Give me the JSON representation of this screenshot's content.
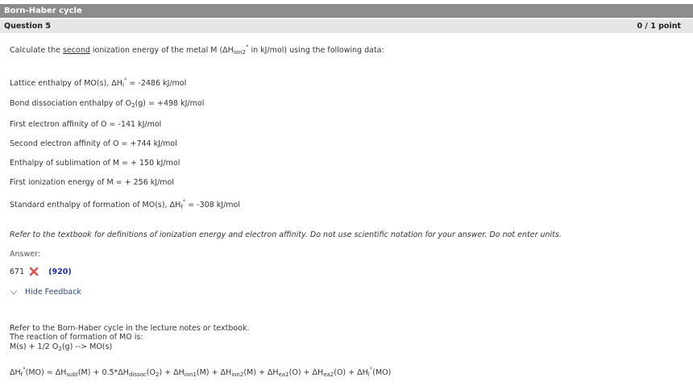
{
  "quiz": {
    "title": "Born-Haber cycle",
    "question_number": "Question 5",
    "points": "0 / 1 point"
  },
  "prompt": {
    "pre": "Calculate the ",
    "underlined": "second",
    "mid": " ionization energy of the metal M (ΔH",
    "sub": "ion2",
    "sup": "°",
    "post": " in kJ/mol) using the following data:"
  },
  "data_lines": [
    {
      "pre": "Lattice enthalpy of MO(s), ΔH",
      "sub": "l",
      "sup": "°",
      "post": " = -2486 kJ/mol"
    },
    {
      "pre": "Bond dissociation enthalpy of O",
      "sub": "2",
      "sup": "",
      "post": "(g) = +498 kJ/mol"
    },
    {
      "pre": "First electron affinity of O = -141 kJ/mol",
      "sub": "",
      "sup": "",
      "post": ""
    },
    {
      "pre": "Second electron affinity of O = +744 kJ/mol",
      "sub": "",
      "sup": "",
      "post": ""
    },
    {
      "pre": "Enthalpy of sublimation of M = + 150 kJ/mol",
      "sub": "",
      "sup": "",
      "post": ""
    },
    {
      "pre": "First ionization energy of M = + 256 kJ/mol",
      "sub": "",
      "sup": "",
      "post": ""
    },
    {
      "pre": "Standard enthalpy of formation of MO(s), ΔH",
      "sub": "f",
      "sup": "°",
      "post": " = -308 kJ/mol"
    }
  ],
  "instruction": "Refer to the textbook for definitions of ionization energy and electron affinity. Do not use scientific notation for your answer. Do not enter units.",
  "answer": {
    "label": "Answer:",
    "value": "671",
    "correct": "(920)",
    "status_icon": "x-icon",
    "status_color": "#e05050"
  },
  "feedback": {
    "toggle_label": "Hide Feedback",
    "line1": "Refer to the Born-Haber cycle in the lecture notes or textbook.",
    "line2": "The reaction of formation of MO is:",
    "line3": {
      "a": "M(s) + 1/2 O",
      "sub": "2",
      "b": "(g) --> MO(s)"
    },
    "equation": [
      {
        "t": "ΔH"
      },
      {
        "sub": "f"
      },
      {
        "sup": "°"
      },
      {
        "t": "(MO) = ΔH"
      },
      {
        "sub": "subl"
      },
      {
        "t": "(M) + 0.5*ΔH"
      },
      {
        "sub": "dissoc"
      },
      {
        "t": "(O"
      },
      {
        "sub": "2"
      },
      {
        "t": ") + ΔH"
      },
      {
        "sub": "ion1"
      },
      {
        "t": "(M) + ΔH"
      },
      {
        "sub": "ion2"
      },
      {
        "t": "(M) + ΔH"
      },
      {
        "sub": "ea1"
      },
      {
        "t": "(O) + ΔH"
      },
      {
        "sub": "ea2"
      },
      {
        "t": "(O) + ΔH"
      },
      {
        "sub": "l"
      },
      {
        "sup": "°"
      },
      {
        "t": "(MO)"
      }
    ]
  }
}
